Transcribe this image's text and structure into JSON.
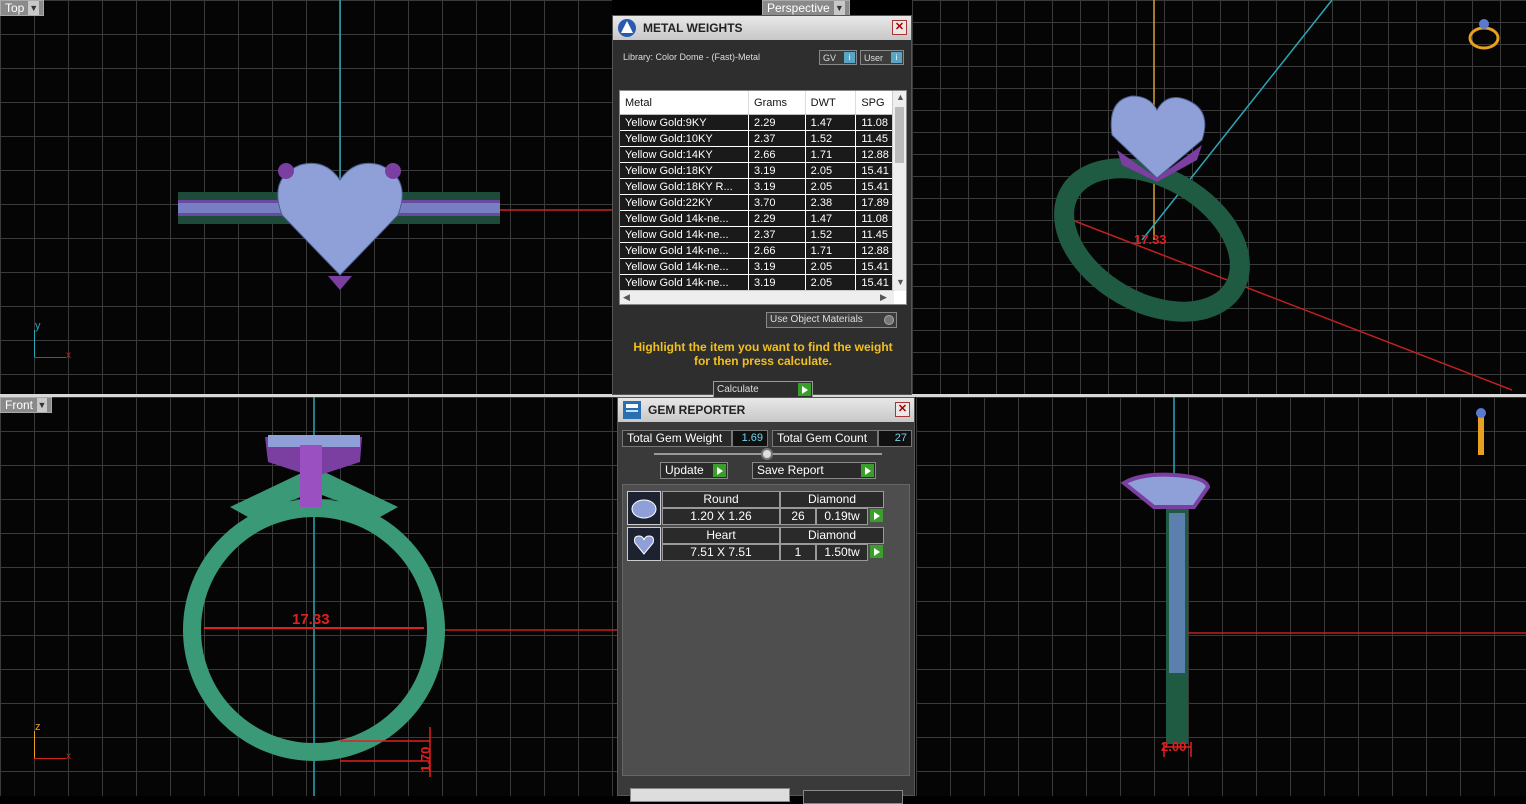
{
  "viewports": {
    "top": {
      "label": "Top"
    },
    "perspective": {
      "label": "Perspective"
    },
    "front": {
      "label": "Front"
    }
  },
  "axes": {
    "top_y": "y",
    "top_x": "x",
    "front_z": "z",
    "front_x": "x"
  },
  "measurements": {
    "ring_size": "17.33",
    "persp_ring_size": "17.33",
    "front_thickness": "1.70",
    "side_width": "2.00"
  },
  "metal_weights": {
    "title": "METAL WEIGHTS",
    "library_label": "Library: Color Dome - (Fast)-Metal",
    "gv_label": "GV",
    "user_label": "User",
    "columns": [
      "Metal",
      "Grams",
      "DWT",
      "SPG"
    ],
    "rows": [
      {
        "metal": "Yellow Gold:9KY",
        "grams": "2.29",
        "dwt": "1.47",
        "spg": "11.08"
      },
      {
        "metal": "Yellow Gold:10KY",
        "grams": "2.37",
        "dwt": "1.52",
        "spg": "11.45"
      },
      {
        "metal": "Yellow Gold:14KY",
        "grams": "2.66",
        "dwt": "1.71",
        "spg": "12.88"
      },
      {
        "metal": "Yellow Gold:18KY",
        "grams": "3.19",
        "dwt": "2.05",
        "spg": "15.41"
      },
      {
        "metal": "Yellow Gold:18KY R...",
        "grams": "3.19",
        "dwt": "2.05",
        "spg": "15.41"
      },
      {
        "metal": "Yellow Gold:22KY",
        "grams": "3.70",
        "dwt": "2.38",
        "spg": "17.89"
      },
      {
        "metal": "Yellow Gold 14k-ne...",
        "grams": "2.29",
        "dwt": "1.47",
        "spg": "11.08"
      },
      {
        "metal": "Yellow Gold 14k-ne...",
        "grams": "2.37",
        "dwt": "1.52",
        "spg": "11.45"
      },
      {
        "metal": "Yellow Gold 14k-ne...",
        "grams": "2.66",
        "dwt": "1.71",
        "spg": "12.88"
      },
      {
        "metal": "Yellow Gold 14k-ne...",
        "grams": "3.19",
        "dwt": "2.05",
        "spg": "15.41"
      },
      {
        "metal": "Yellow Gold 14k-ne...",
        "grams": "3.19",
        "dwt": "2.05",
        "spg": "15.41"
      }
    ],
    "use_object_materials": "Use Object Materials",
    "hint_line1": "Highlight the item you want to find the weight",
    "hint_line2": "for then press calculate.",
    "calculate_label": "Calculate"
  },
  "gem_reporter": {
    "title": "GEM REPORTER",
    "total_weight_label": "Total Gem Weight",
    "total_weight_value": "1.69",
    "total_count_label": "Total Gem Count",
    "total_count_value": "27",
    "update_label": "Update",
    "save_report_label": "Save Report",
    "gems": [
      {
        "shape": "Round",
        "type": "Diamond",
        "size": "1.20 X 1.26",
        "count": "26",
        "weight": "0.19tw"
      },
      {
        "shape": "Heart",
        "type": "Diamond",
        "size": "7.51 X 7.51",
        "count": "1",
        "weight": "1.50tw"
      }
    ]
  },
  "colors": {
    "band": "#2d7a55",
    "prong": "#7a3fa0",
    "gem": "#8fa0d8",
    "measure": "#e02020",
    "hint": "#f0c020"
  }
}
